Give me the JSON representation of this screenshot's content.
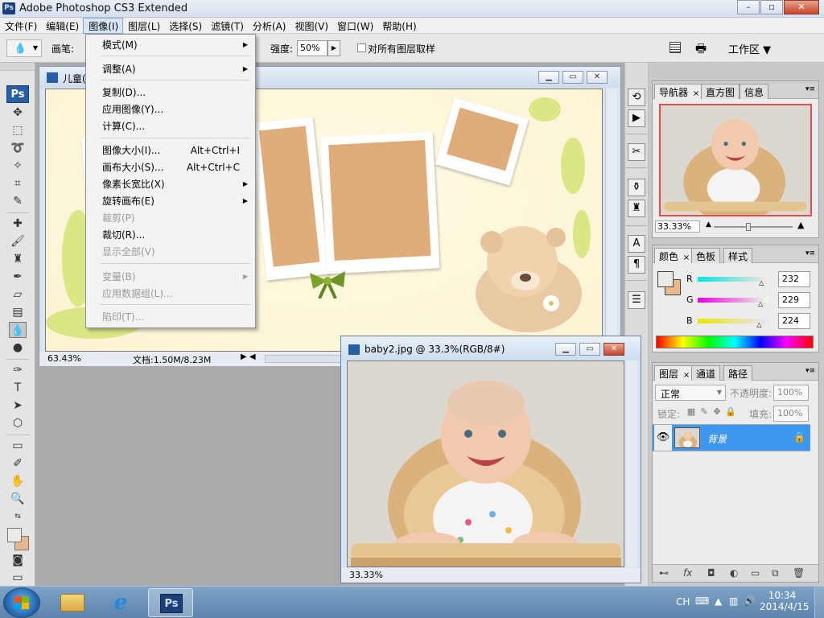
{
  "app": {
    "title": "Adobe Photoshop CS3 Extended",
    "logo_text": "Ps",
    "window_buttons": [
      "–",
      "▫",
      "✕"
    ]
  },
  "menubar": {
    "items": [
      "文件(F)",
      "编辑(E)",
      "图像(I)",
      "图层(L)",
      "选择(S)",
      "滤镜(T)",
      "分析(A)",
      "视图(V)",
      "窗口(W)",
      "帮助(H)"
    ],
    "active_index": 2
  },
  "options": {
    "brush_label": "画笔:",
    "strength_label": "强度:",
    "strength_value": "50%",
    "sample_all_label": "对所有图层取样",
    "workspace_label": "工作区 ▼"
  },
  "toolbox": {
    "badge": "Ps"
  },
  "image_menu": {
    "items": [
      {
        "label": "模式(M)",
        "shortcut": "",
        "submenu": true,
        "disabled": false
      },
      {
        "label": "调整(A)",
        "shortcut": "",
        "submenu": true,
        "disabled": false
      },
      {
        "label": "复制(D)...",
        "shortcut": "",
        "submenu": false,
        "disabled": false
      },
      {
        "label": "应用图像(Y)...",
        "shortcut": "",
        "submenu": false,
        "disabled": false
      },
      {
        "label": "计算(C)...",
        "shortcut": "",
        "submenu": false,
        "disabled": false
      },
      {
        "label": "图像大小(I)...",
        "shortcut": "Alt+Ctrl+I",
        "submenu": false,
        "disabled": false
      },
      {
        "label": "画布大小(S)...",
        "shortcut": "Alt+Ctrl+C",
        "submenu": false,
        "disabled": false
      },
      {
        "label": "像素长宽比(X)",
        "shortcut": "",
        "submenu": true,
        "disabled": false
      },
      {
        "label": "旋转画布(E)",
        "shortcut": "",
        "submenu": true,
        "disabled": false
      },
      {
        "label": "裁剪(P)",
        "shortcut": "",
        "submenu": false,
        "disabled": true
      },
      {
        "label": "裁切(R)...",
        "shortcut": "",
        "submenu": false,
        "disabled": false
      },
      {
        "label": "显示全部(V)",
        "shortcut": "",
        "submenu": false,
        "disabled": true
      },
      {
        "label": "变量(B)",
        "shortcut": "",
        "submenu": true,
        "disabled": true
      },
      {
        "label": "应用数据组(L)...",
        "shortcut": "",
        "submenu": false,
        "disabled": true
      },
      {
        "label": "陷印(T)...",
        "shortcut": "",
        "submenu": false,
        "disabled": true
      }
    ]
  },
  "doc1": {
    "title": "儿童(",
    "zoom": "63.43%",
    "doc_size": "文档:1.50M/8.23M"
  },
  "doc2": {
    "title": "baby2.jpg @ 33.3%(RGB/8#)",
    "zoom": "33.33%"
  },
  "navigator": {
    "tabs": [
      "导航器",
      "直方图",
      "信息"
    ],
    "zoom": "33.33%"
  },
  "color_panel": {
    "tabs": [
      "颜色",
      "色板",
      "样式"
    ],
    "channels": [
      {
        "label": "R",
        "value": "232"
      },
      {
        "label": "G",
        "value": "229"
      },
      {
        "label": "B",
        "value": "224"
      }
    ],
    "channel_levels": [
      232,
      229,
      224
    ],
    "fg_color": "#eae5e0",
    "bg_color": "#e8b88b"
  },
  "layers_panel": {
    "tabs": [
      "图层",
      "通道",
      "路径"
    ],
    "blend_mode": "正常",
    "opacity_label": "不透明度:",
    "opacity_value": "100%",
    "lock_label": "锁定:",
    "fill_label": "填充:",
    "fill_value": "100%",
    "layer_name": "背景"
  },
  "taskbar": {
    "ime": "CH",
    "time": "10:34",
    "date": "2014/4/15"
  }
}
